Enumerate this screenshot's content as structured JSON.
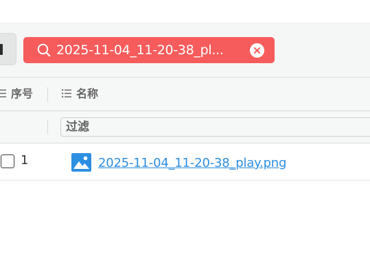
{
  "search": {
    "chip_text": "2025-11-04_11-20-38_pl..."
  },
  "table": {
    "columns": [
      "序号",
      "名称"
    ],
    "filter_placeholder": "过滤",
    "rows": [
      {
        "index": "1",
        "name": "2025-11-04_11-20-38_play.png",
        "checked": false
      }
    ]
  },
  "icons": {
    "search": "magnifier-icon",
    "clear": "clear-circle-x-icon",
    "column": "list-icon",
    "file": "image-file-icon"
  },
  "colors": {
    "chip_background": "#f65c5c",
    "link": "#2c8de0",
    "header_text": "#666666",
    "file_icon": "#2d8fe2"
  }
}
